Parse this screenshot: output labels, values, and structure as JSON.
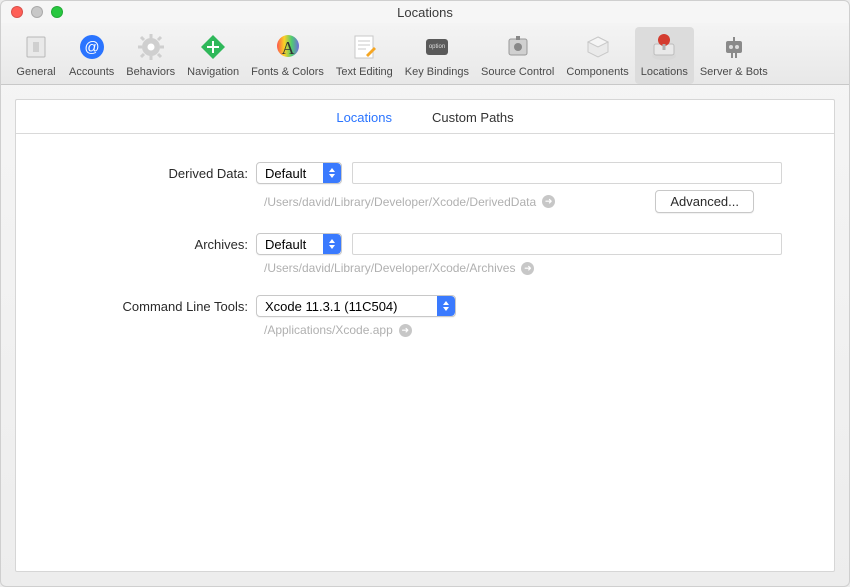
{
  "window": {
    "title": "Locations"
  },
  "toolbar": {
    "items": [
      {
        "label": "General"
      },
      {
        "label": "Accounts"
      },
      {
        "label": "Behaviors"
      },
      {
        "label": "Navigation"
      },
      {
        "label": "Fonts & Colors"
      },
      {
        "label": "Text Editing"
      },
      {
        "label": "Key Bindings"
      },
      {
        "label": "Source Control"
      },
      {
        "label": "Components"
      },
      {
        "label": "Locations"
      },
      {
        "label": "Server & Bots"
      }
    ]
  },
  "tabs": {
    "locations": "Locations",
    "custom_paths": "Custom Paths"
  },
  "rows": {
    "derived_data": {
      "label": "Derived Data:",
      "value": "Default",
      "path": "/Users/david/Library/Developer/Xcode/DerivedData",
      "advanced": "Advanced..."
    },
    "archives": {
      "label": "Archives:",
      "value": "Default",
      "path": "/Users/david/Library/Developer/Xcode/Archives"
    },
    "clt": {
      "label": "Command Line Tools:",
      "value": "Xcode 11.3.1 (11C504)",
      "path": "/Applications/Xcode.app"
    }
  }
}
